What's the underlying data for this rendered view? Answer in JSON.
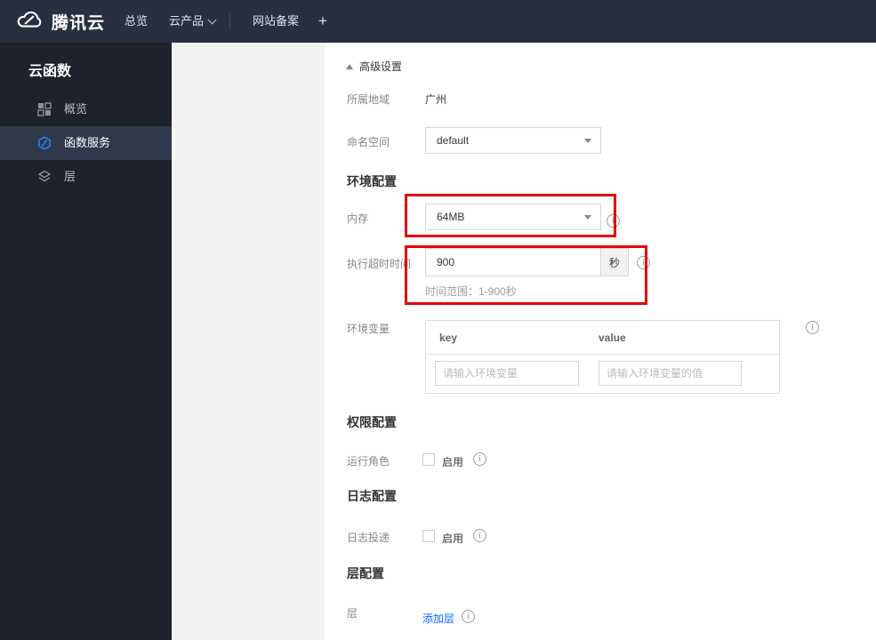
{
  "topbar": {
    "logo_text": "腾讯云",
    "overview_label": "总览",
    "products_label": "云产品",
    "icp_label": "网站备案",
    "plus_label": "+"
  },
  "sidebar": {
    "title": "云函数",
    "items": [
      {
        "label": "概览",
        "icon": "grid-icon",
        "selected": false
      },
      {
        "label": "函数服务",
        "icon": "function-hexagon-icon",
        "selected": true
      },
      {
        "label": "层",
        "icon": "layers-icon",
        "selected": false
      }
    ]
  },
  "main": {
    "advanced_toggle": {
      "label": "高级设置",
      "state": "expanded"
    },
    "region": {
      "label": "所属地域",
      "value": "广州"
    },
    "namespace": {
      "label": "命名空间",
      "value": "default"
    },
    "env_section_title": "环境配置",
    "memory": {
      "label": "内存",
      "value": "64MB"
    },
    "timeout": {
      "label": "执行超时时间",
      "value": "900",
      "unit": "秒",
      "hint": "时间范围：1-900秒"
    },
    "env_vars": {
      "label": "环境变量",
      "columns": [
        "key",
        "value"
      ],
      "key_placeholder": "请输入环境变量",
      "value_placeholder": "请输入环境变量的值"
    },
    "perm_section_title": "权限配置",
    "run_role": {
      "label": "运行角色",
      "checkbox_label": "启用",
      "checked": false
    },
    "log_section_title": "日志配置",
    "log_delivery": {
      "label": "日志投递",
      "checkbox_label": "启用",
      "checked": false
    },
    "layer_section_title": "层配置",
    "layer": {
      "label": "层",
      "add_link_label": "添加层"
    }
  },
  "colors": {
    "accent_blue": "#006eff",
    "annotation_red": "#e60000",
    "topbar_bg": "#27303f",
    "sidebar_bg": "#1e222d"
  }
}
